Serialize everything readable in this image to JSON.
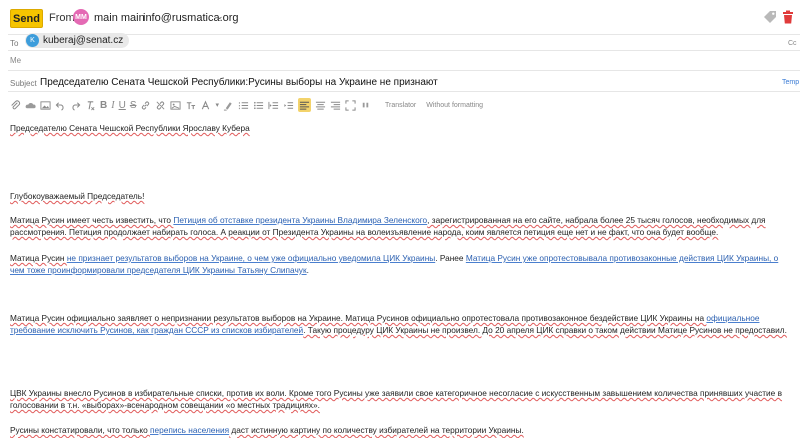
{
  "header": {
    "send_label": "Send",
    "from_label": "From:",
    "avatar_initials": "MM",
    "from_name": "main main",
    "from_email": "info@rusmatica.org"
  },
  "to": {
    "label": "To",
    "chip_initial": "K",
    "recipient": "kuberaj@senat.cz",
    "cc_label": "Cc"
  },
  "me": {
    "label": "Me"
  },
  "subject": {
    "label": "Subject",
    "value": "Председателю Сената Чешской Республики:Русины выборы на Украине не признают",
    "templates_label": "Temp"
  },
  "toolbar": {
    "bold": "B",
    "italic": "I",
    "underline": "U",
    "strike": "S",
    "translator": "Translator",
    "without_formatting": "Without formatting"
  },
  "colors": {
    "send": "#f6c400",
    "avatar": "#e46ab4",
    "chip_avatar": "#3d9ddb",
    "link": "#2a5fb0",
    "trash": "#e03b3b"
  },
  "body": {
    "p1": "Председателю Сената Чешской Республики Ярославу Кубера",
    "p2": "Глубокоуважаемый Председатель!",
    "p3a": "Матица Русин имеет честь известить, что ",
    "p3link": "Петиция об отставке президента Украины Владимира Зеленского",
    "p3b": ", зарегистрированная на его сайте, набрала более 25 тысяч голосов, необходимых для рассмотрения. Петиция продолжает набирать голоса. А реакции от Президента Украины на волеизъявление народа, коим является петиция еще нет и не факт, что она будет вообще.",
    "p4a": "Матица Русин ",
    "p4link1": "не признает результатов выборов на Украине, о чем уже официально уведомила ЦИК Украины",
    "p4b": ". Ранее ",
    "p4link2": "Матица Русин уже опротестовывала противозаконные действия ЦИК Украины, о чем тоже проинформировали председателя ЦИК Украины Татьяну Слипачук",
    "p4c": ".",
    "p5a": "Матица Русин официально заявляет о непризнании результатов выборов на Украине. Матица Русинов официально опротестовала противозаконное бездействие ЦИК Украины на ",
    "p5link": "официальное требование исключить Русинов, как граждан СССР из списков избирателей",
    "p5b": ". Такую процедуру ЦИК Украины не произвел. До 20 апреля ЦИК справки о таком действии Матице Русинов не предоставил.",
    "p6": "ЦВК Украины внесло Русинов в избирательные списки, против их воли. Кроме того Русины уже заявили свое категоричное несогласие с искусственным завышением количества принявших участие в голосовании в т.н. «выборах»-всенародном совещании «о местных традициях».",
    "p7a": "Русины констатировали, что только ",
    "p7link": "перепись населения",
    "p7b": " даст истинную картину по количеству избирателей на территории Украины."
  }
}
